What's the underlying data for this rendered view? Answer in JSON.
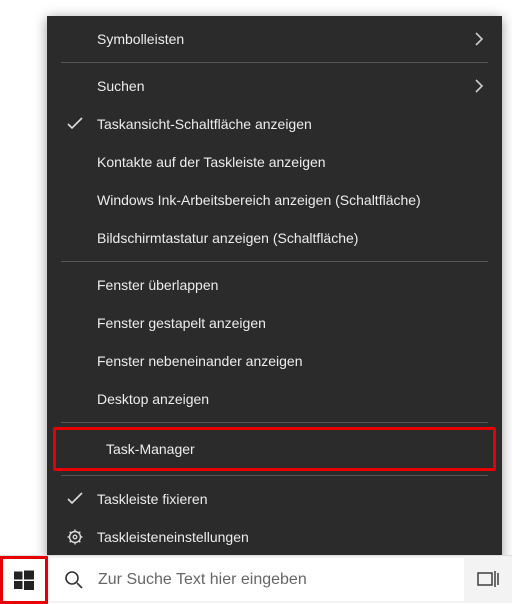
{
  "menu": {
    "toolbars": "Symbolleisten",
    "search": "Suchen",
    "taskview_btn": "Taskansicht-Schaltfläche anzeigen",
    "contacts": "Kontakte auf der Taskleiste anzeigen",
    "ink": "Windows Ink-Arbeitsbereich anzeigen (Schaltfläche)",
    "osk": "Bildschirmtastatur anzeigen (Schaltfläche)",
    "cascade": "Fenster überlappen",
    "stacked": "Fenster gestapelt anzeigen",
    "sidebyside": "Fenster nebeneinander anzeigen",
    "show_desktop": "Desktop anzeigen",
    "task_manager": "Task-Manager",
    "lock_taskbar": "Taskleiste fixieren",
    "taskbar_settings": "Taskleisteneinstellungen"
  },
  "taskbar": {
    "search_placeholder": "Zur Suche Text hier eingeben"
  }
}
